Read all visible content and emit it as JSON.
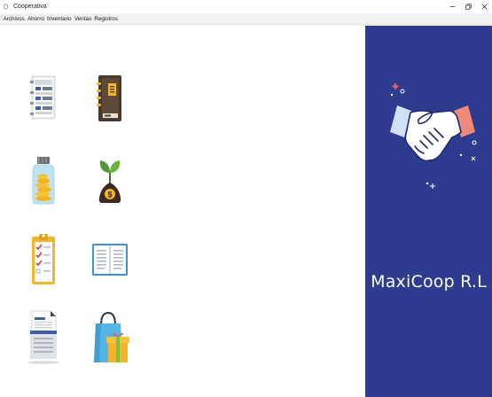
{
  "window": {
    "title": "Cooperativa",
    "controls": [
      "minimize",
      "restore",
      "close"
    ]
  },
  "menu": {
    "items": [
      "Archivos",
      "Ahorro",
      "Inventario",
      "Ventas",
      "Registros"
    ]
  },
  "tiles": [
    {
      "name": "document-list-icon"
    },
    {
      "name": "address-book-icon"
    },
    {
      "name": "coin-jar-icon"
    },
    {
      "name": "money-plant-icon"
    },
    {
      "name": "checklist-clipboard-icon"
    },
    {
      "name": "open-book-icon"
    },
    {
      "name": "printer-report-icon"
    },
    {
      "name": "shopping-bag-gift-icon"
    }
  ],
  "side_panel": {
    "brand": "MaxiCoop R.L",
    "background": "#2e3b8f",
    "illustration": "handshake-icon"
  }
}
